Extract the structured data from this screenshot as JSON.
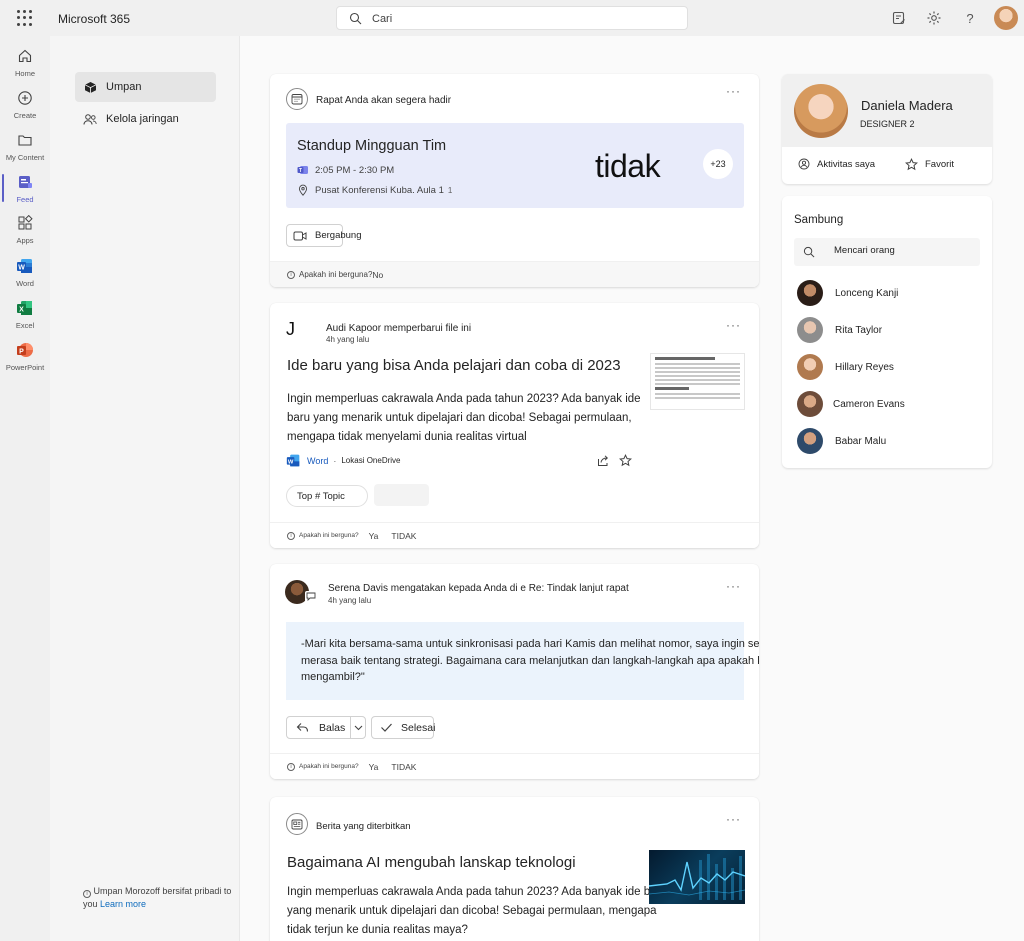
{
  "app": {
    "brand": "Microsoft 365",
    "search_placeholder": "Cari"
  },
  "rail": {
    "items": [
      {
        "label": "Home",
        "icon": "home-icon"
      },
      {
        "label": "Create",
        "icon": "plus-circle-icon"
      },
      {
        "label": "My Content",
        "icon": "folder-icon"
      },
      {
        "label": "Feed",
        "icon": "feed-icon"
      },
      {
        "label": "Apps",
        "icon": "apps-grid-icon"
      },
      {
        "label": "Word",
        "icon": "word-icon"
      },
      {
        "label": "Excel",
        "icon": "excel-icon"
      },
      {
        "label": "PowerPoint",
        "icon": "powerpoint-icon"
      }
    ],
    "active": "Feed",
    "accent": "#5b5fc7"
  },
  "nav": {
    "items": [
      {
        "label": "Umpan",
        "icon": "feed-cube-icon"
      },
      {
        "label": "Kelola jaringan",
        "icon": "people-icon"
      }
    ],
    "privacy_text": "Umpan Morozoff bersifat pribadi to you",
    "learn_more": "Learn more"
  },
  "feed": {
    "meeting": {
      "header": "Rapat Anda akan segera hadir",
      "title": "Standup Mingguan Tim",
      "time": "2:05 PM - 2:30 PM",
      "location": "Pusat Konferensi Kuba. Aula 1",
      "location_count": "1",
      "overlay": "tidak",
      "attendees_badge": "+23",
      "join": "Bergabung",
      "feedback_q": "Apakah ini berguna?",
      "feedback_no": "No"
    },
    "file": {
      "initial": "J",
      "header": "Audi Kapoor memperbarui file ini",
      "time": "4h yang lalu",
      "title": "Ide baru yang bisa Anda pelajari dan coba di 2023",
      "body": "Ingin memperluas cakrawala Anda pada tahun 2023? Ada banyak ide baru yang menarik untuk dipelajari dan dicoba! Sebagai permulaan, mengapa tidak menyelami dunia realitas virtual",
      "app_name": "Word",
      "location": "Lokasi OneDrive",
      "topic": "Top # Topic",
      "feedback_q": "Apakah ini berguna?",
      "feedback_yes": "Ya",
      "feedback_no": "TIDAK"
    },
    "comment": {
      "header": "Serena Davis mengatakan kepada Anda di e Re: Tindak lanjut rapat",
      "time": "4h yang lalu",
      "quote": "-Mari kita bersama-sama untuk sinkronisasi pada hari Kamis dan melihat nomor, saya ingin semua orang merasa baik tentang strategi. Bagaimana cara melanjutkan dan langkah-langkah apa apakah kita mengambil?\"",
      "reply": "Balas",
      "done": "Selesai",
      "feedback_q": "Apakah ini berguna?",
      "feedback_yes": "Ya",
      "feedback_no": "TIDAK"
    },
    "news": {
      "header": "Berita yang diterbitkan",
      "title": "Bagaimana AI mengubah lanskap teknologi",
      "body": "Ingin memperluas cakrawala Anda pada tahun 2023? Ada banyak ide baru yang menarik untuk dipelajari dan dicoba! Sebagai permulaan, mengapa tidak terjun ke dunia realitas maya?"
    }
  },
  "profile": {
    "name": "Daniela Madera",
    "role": "DESIGNER 2",
    "activity": "Aktivitas saya",
    "favorites": "Favorit"
  },
  "connect": {
    "title": "Sambung",
    "search_placeholder": "Mencari orang",
    "people": [
      {
        "name": "Lonceng Kanji",
        "color": "#3a2a22"
      },
      {
        "name": "Rita Taylor",
        "color": "#9a9a9a"
      },
      {
        "name": "Hillary Reyes",
        "color": "#b57b52"
      },
      {
        "name": "Cameron Evans",
        "color": "#7a5a45"
      },
      {
        "name": "Babar Malu",
        "color": "#2f4a6b"
      }
    ]
  }
}
